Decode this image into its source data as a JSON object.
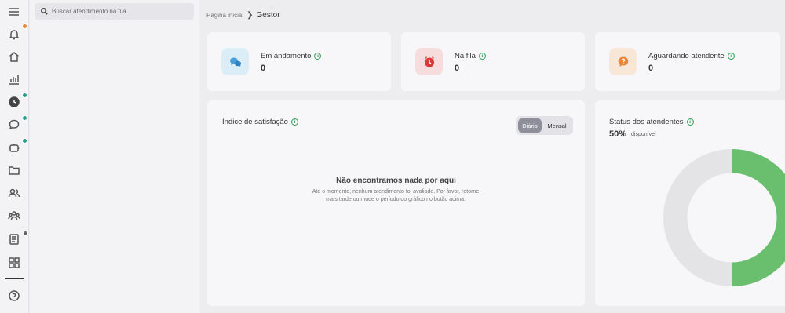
{
  "search": {
    "placeholder": "Buscar atendimento na fila"
  },
  "breadcrumb": {
    "home": "Pagina inicial",
    "current": "Gestor"
  },
  "rail": {
    "items": [
      {
        "icon": "menu-icon"
      },
      {
        "icon": "bell-icon",
        "badge_color": "#e8863a"
      },
      {
        "icon": "home-icon"
      },
      {
        "icon": "bar-chart-icon"
      },
      {
        "icon": "clock-icon",
        "badge_color": "#2e9e8a"
      },
      {
        "icon": "chat-icon",
        "badge_color": "#2e9e8a"
      },
      {
        "icon": "robot-icon",
        "badge_color": "#2e9e8a"
      },
      {
        "icon": "folder-icon"
      },
      {
        "icon": "users-icon"
      },
      {
        "icon": "team-icon"
      },
      {
        "icon": "contacts-icon",
        "badge_color": "#666666"
      },
      {
        "icon": "grid-icon"
      },
      {
        "icon": "help-icon"
      }
    ]
  },
  "stats": [
    {
      "label": "Em andamento",
      "value": "0",
      "icon": "chat-bubbles-icon",
      "color": "#4a9fd8",
      "bg": "#dbeef8"
    },
    {
      "label": "Na fila",
      "value": "0",
      "icon": "alarm-clock-icon",
      "color": "#d83a3a",
      "bg": "#f6dcdc"
    },
    {
      "label": "Aguardando atendente",
      "value": "0",
      "icon": "question-chat-icon",
      "color": "#e8863a",
      "bg": "#f8e7d7"
    }
  ],
  "satisfaction": {
    "title": "Índice de satisfação",
    "toggle": {
      "active": "Diário",
      "other": "Mensal"
    },
    "empty_title": "Não encontramos nada por aqui",
    "empty_text": "Até o momento, nenhum atendimento foi avaliado. Por favor, retorne mais tarde ou mude o período do gráfico no botão acima."
  },
  "agents_status": {
    "title": "Status dos atendentes",
    "percent": "50%",
    "percent_label": "disponível",
    "available_fraction": 0.5,
    "colors": {
      "available": "#6abf6e",
      "other": "#e4e4e7"
    }
  },
  "colors": {
    "accent_green": "#2e9e55"
  }
}
